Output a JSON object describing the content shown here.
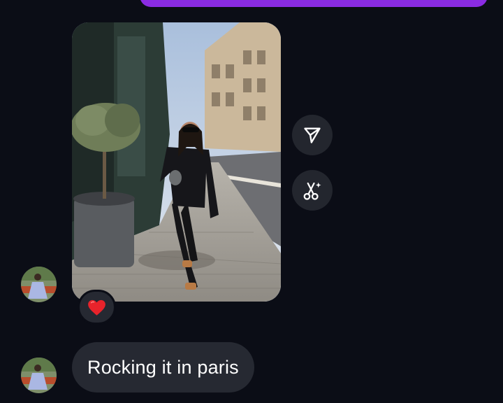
{
  "thread": {
    "incoming_message": {
      "type": "photo",
      "image_description": "woman in black outfit walking on a Paris sidewalk"
    },
    "reaction": {
      "emoji": "❤️",
      "icon": "heart-icon"
    },
    "text_message": {
      "text": "Rocking it in paris"
    }
  },
  "actions": [
    {
      "icon": "send-icon"
    },
    {
      "icon": "remix-scissors-icon"
    }
  ],
  "colors": {
    "background": "#0b0d16",
    "bubble": "#262932",
    "outgoing_bubble": "#8a2be2",
    "action_button": "#23262e"
  }
}
